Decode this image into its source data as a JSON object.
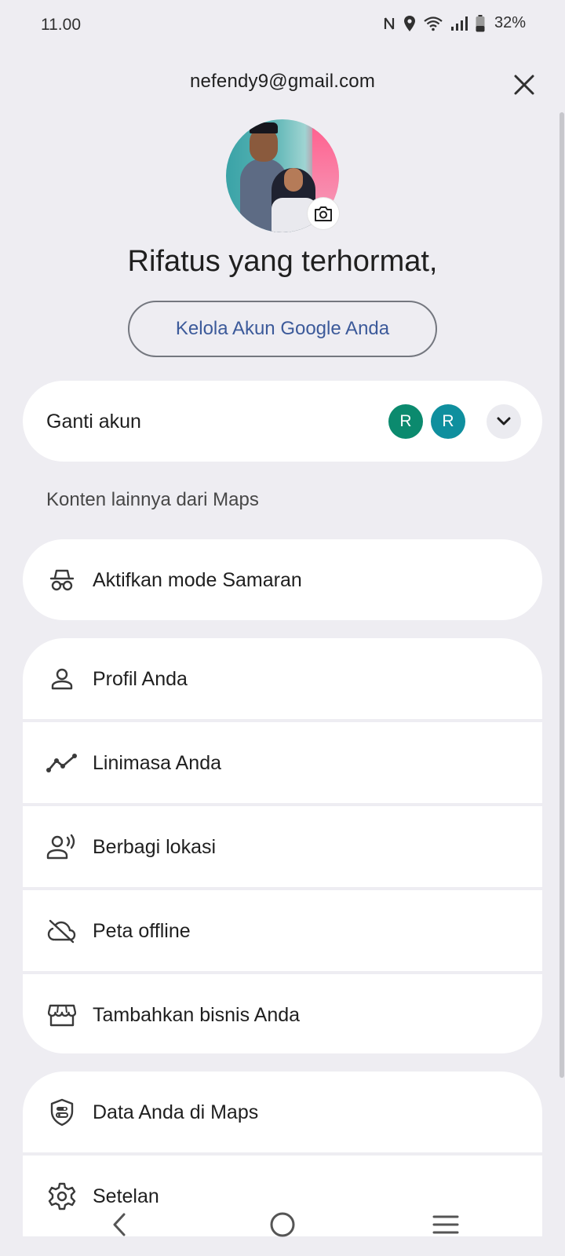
{
  "status_bar": {
    "time": "11.00",
    "battery": "32%",
    "icons": [
      "nfc-icon",
      "location-icon",
      "wifi-icon",
      "signal-icon",
      "battery-icon"
    ]
  },
  "header": {
    "email": "nefendy9@gmail.com",
    "greeting": "Rifatus yang terhormat,",
    "manage_button": "Kelola Akun Google Anda"
  },
  "switch_account": {
    "label": "Ganti akun",
    "avatars": [
      {
        "letter": "R",
        "color": "#0b8a6e"
      },
      {
        "letter": "R",
        "color": "#0f8f9e"
      }
    ]
  },
  "section": {
    "heading": "Konten lainnya dari Maps"
  },
  "incognito": {
    "label": "Aktifkan mode Samaran",
    "icon": "incognito-icon"
  },
  "menu_group_1": [
    {
      "label": "Profil Anda",
      "icon": "person-icon"
    },
    {
      "label": "Linimasa Anda",
      "icon": "timeline-icon"
    },
    {
      "label": "Berbagi lokasi",
      "icon": "location-sharing-icon"
    },
    {
      "label": "Peta offline",
      "icon": "offline-cloud-icon"
    },
    {
      "label": "Tambahkan bisnis Anda",
      "icon": "storefront-icon"
    }
  ],
  "menu_group_2": [
    {
      "label": "Data Anda di Maps",
      "icon": "shield-icon"
    },
    {
      "label": "Setelan",
      "icon": "gear-icon"
    }
  ],
  "colors": {
    "background": "#eeedf2",
    "card": "#ffffff",
    "link_blue": "#3c5a9a"
  }
}
